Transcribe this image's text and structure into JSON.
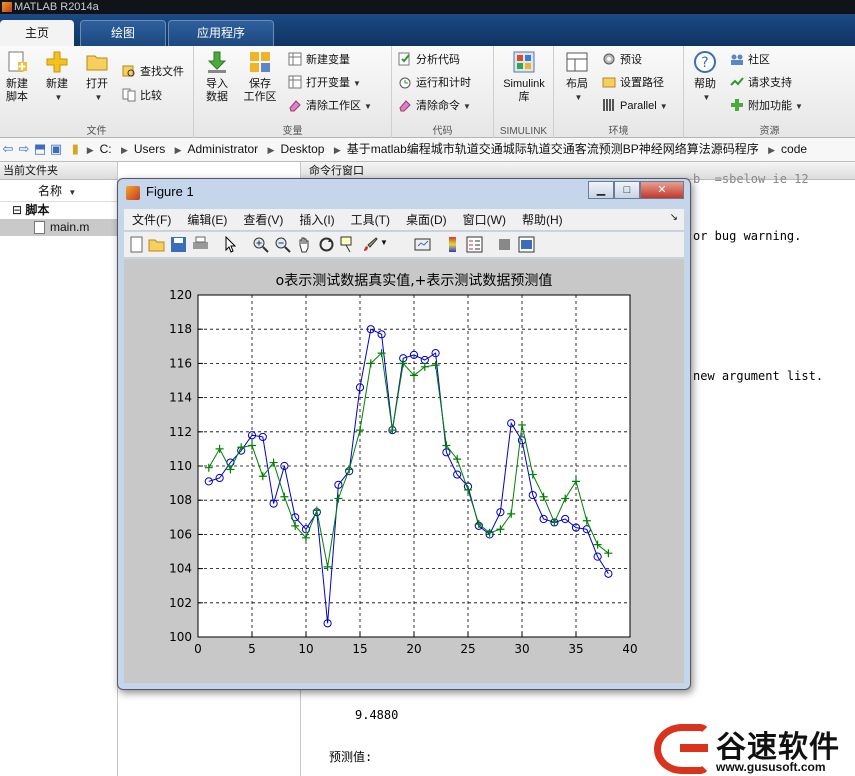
{
  "app": {
    "title": "MATLAB R2014a"
  },
  "tabs": [
    "主页",
    "绘图",
    "应用程序"
  ],
  "ribbon": {
    "groups": {
      "file": "文件",
      "variable": "变量",
      "code": "代码",
      "simulink": "SIMULINK",
      "environment": "环境",
      "resources": "资源"
    },
    "new_script": [
      "新建",
      "脚本"
    ],
    "new": "新建",
    "open": "打开",
    "find_files": "查找文件",
    "compare": "比较",
    "import_data": [
      "导入",
      "数据"
    ],
    "save_workspace": [
      "保存",
      "工作区"
    ],
    "new_variable": "新建变量",
    "open_variable": "打开变量",
    "clear_workspace": "清除工作区",
    "analyze_code": "分析代码",
    "run_and_time": "运行和计时",
    "clear_commands": "清除命令",
    "simulink": [
      "Simulink",
      "库"
    ],
    "layout": "布局",
    "preferences": "预设",
    "set_path": "设置路径",
    "parallel": "Parallel",
    "help": "帮助",
    "community": "社区",
    "request_support": "请求支持",
    "add_ons": "附加功能"
  },
  "address": {
    "crumbs": [
      "C:",
      "Users",
      "Administrator",
      "Desktop",
      "基于matlab编程城市轨道交通城际轨道交通客流预测BP神经网络算法源码程序",
      "code"
    ]
  },
  "left_panel": {
    "title": "当前文件夹",
    "column_name": "名称",
    "folder": "脚本",
    "file": "main.m"
  },
  "command_window": {
    "title": "命令行窗口",
    "line_top": "b  =sbelow ie 12",
    "line_warning": "or bug warning.",
    "line_arglist": "new argument list.",
    "line_value": "9.4880",
    "line_pred": "预测值:"
  },
  "figure": {
    "title": "Figure 1",
    "menu": [
      "文件(F)",
      "编辑(E)",
      "查看(V)",
      "插入(I)",
      "工具(T)",
      "桌面(D)",
      "窗口(W)",
      "帮助(H)"
    ]
  },
  "watermark": {
    "text": "谷速软件",
    "url": "www.gususoft.com"
  },
  "chart_data": {
    "type": "line",
    "title": "o表示测试数据真实值,+表示测试数据预测值",
    "xlim": [
      0,
      40
    ],
    "ylim": [
      100,
      120
    ],
    "xticks": [
      0,
      5,
      10,
      15,
      20,
      25,
      30,
      35,
      40
    ],
    "yticks": [
      100,
      102,
      104,
      106,
      108,
      110,
      112,
      114,
      116,
      118,
      120
    ],
    "grid": true,
    "series": [
      {
        "marker": "o",
        "color": "#0000cc",
        "x": [
          1,
          2,
          3,
          4,
          5,
          6,
          7,
          8,
          9,
          10,
          11,
          12,
          13,
          14,
          15,
          16,
          17,
          18,
          19,
          20,
          21,
          22,
          23,
          24,
          25,
          26,
          27,
          28,
          29,
          30,
          31,
          32,
          33,
          34,
          35,
          36,
          37,
          38
        ],
        "values": [
          109.1,
          109.3,
          110.2,
          110.9,
          111.8,
          111.7,
          107.8,
          110.0,
          107.0,
          106.3,
          107.3,
          100.8,
          108.9,
          109.7,
          114.6,
          118.0,
          117.7,
          112.1,
          116.3,
          116.5,
          116.2,
          116.6,
          110.8,
          109.5,
          108.8,
          106.5,
          106.0,
          107.3,
          112.5,
          111.5,
          108.3,
          106.9,
          106.7,
          106.9,
          106.4,
          106.3,
          104.7,
          103.7
        ]
      },
      {
        "marker": "+",
        "color": "#008000",
        "x": [
          1,
          2,
          3,
          4,
          5,
          6,
          7,
          8,
          9,
          10,
          11,
          12,
          13,
          14,
          15,
          16,
          17,
          18,
          19,
          20,
          21,
          22,
          23,
          24,
          25,
          26,
          27,
          28,
          29,
          30,
          31,
          32,
          33,
          34,
          35,
          36,
          37,
          38
        ],
        "values": [
          109.9,
          111.0,
          109.8,
          111.1,
          111.2,
          109.4,
          110.2,
          108.2,
          106.5,
          105.8,
          107.4,
          104.1,
          108.1,
          109.8,
          112.1,
          116.0,
          116.6,
          112.1,
          116.0,
          115.3,
          115.8,
          115.9,
          111.2,
          110.4,
          108.6,
          106.6,
          106.1,
          106.3,
          107.2,
          112.4,
          109.5,
          108.2,
          106.7,
          108.1,
          109.1,
          106.8,
          105.4,
          104.9
        ]
      }
    ]
  }
}
